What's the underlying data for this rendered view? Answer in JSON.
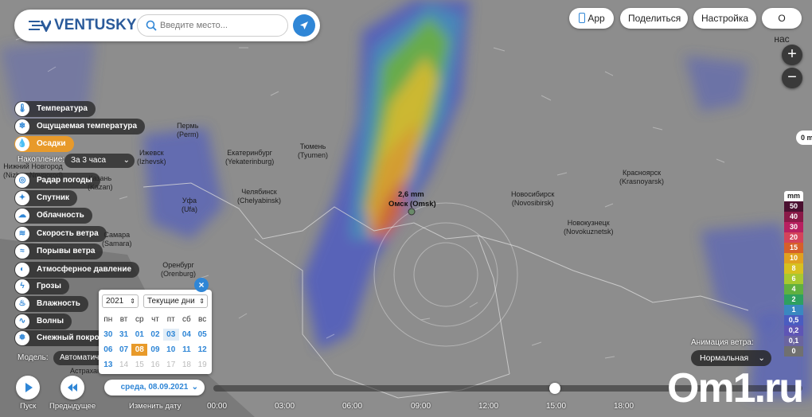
{
  "header": {
    "logo_text": "VENTUSKY",
    "search_placeholder": "Введите место..."
  },
  "top_buttons": {
    "app": "App",
    "share": "Поделиться",
    "settings": "Настройка",
    "about": "О нас"
  },
  "zoom": {
    "in": "+",
    "out": "−"
  },
  "layers": [
    {
      "label": "Температура",
      "icon": "thermometer-icon"
    },
    {
      "label": "Ощущаемая температура",
      "icon": "feels-like-icon"
    },
    {
      "label": "Осадки",
      "icon": "drop-icon",
      "active": true
    },
    {
      "label": "Радар погоды",
      "icon": "radar-icon"
    },
    {
      "label": "Спутник",
      "icon": "satellite-icon"
    },
    {
      "label": "Облачность",
      "icon": "cloud-icon"
    },
    {
      "label": "Скорость ветра",
      "icon": "wind-icon"
    },
    {
      "label": "Порывы ветра",
      "icon": "gust-icon"
    },
    {
      "label": "Атмосферное давление",
      "icon": "pressure-icon"
    },
    {
      "label": "Грозы",
      "icon": "lightning-icon"
    },
    {
      "label": "Влажность",
      "icon": "humidity-icon"
    },
    {
      "label": "Волны",
      "icon": "waves-icon"
    },
    {
      "label": "Снежный покров",
      "icon": "snowflake-icon"
    }
  ],
  "accumulation": {
    "label": "Накопление:",
    "value": "За 3 часа"
  },
  "model": {
    "label": "Модель:",
    "value": "Автоматич"
  },
  "calendar": {
    "year": "2021",
    "range": "Текущие дни",
    "weekdays": [
      "пн",
      "вт",
      "ср",
      "чт",
      "пт",
      "сб",
      "вс"
    ],
    "days": [
      {
        "t": "30"
      },
      {
        "t": "31"
      },
      {
        "t": "01"
      },
      {
        "t": "02"
      },
      {
        "t": "03",
        "hi": true
      },
      {
        "t": "04"
      },
      {
        "t": "05"
      },
      {
        "t": "06"
      },
      {
        "t": "07"
      },
      {
        "t": "08",
        "today": true
      },
      {
        "t": "09"
      },
      {
        "t": "10"
      },
      {
        "t": "11"
      },
      {
        "t": "12"
      },
      {
        "t": "13"
      },
      {
        "t": "14",
        "dim": true
      },
      {
        "t": "15",
        "dim": true
      },
      {
        "t": "16",
        "dim": true
      },
      {
        "t": "17",
        "dim": true
      },
      {
        "t": "18",
        "dim": true
      },
      {
        "t": "19",
        "dim": true
      }
    ]
  },
  "bottom": {
    "play": "Пуск",
    "previous": "Предыдущее",
    "change_date": "Изменить дату",
    "date": "среда, 08.09.2021",
    "hours": [
      "00:00",
      "03:00",
      "06:00",
      "09:00",
      "12:00",
      "15:00",
      "18:00"
    ],
    "timeline_position": 0.58
  },
  "wind_animation": {
    "label": "Анимация ветра:",
    "value": "Нормальная"
  },
  "legend": {
    "unit": "mm",
    "items": [
      {
        "v": "50",
        "c": "#4a1030"
      },
      {
        "v": "40",
        "c": "#8a1a48"
      },
      {
        "v": "30",
        "c": "#b82060"
      },
      {
        "v": "20",
        "c": "#d4435a"
      },
      {
        "v": "15",
        "c": "#d65f2a"
      },
      {
        "v": "10",
        "c": "#e0a020"
      },
      {
        "v": "8",
        "c": "#d7c020"
      },
      {
        "v": "6",
        "c": "#a8c830"
      },
      {
        "v": "4",
        "c": "#60b040"
      },
      {
        "v": "2",
        "c": "#2ea060"
      },
      {
        "v": "1",
        "c": "#3a88c0"
      },
      {
        "v": "0,5",
        "c": "#4a5cc0"
      },
      {
        "v": "0,2",
        "c": "#5e55b5"
      },
      {
        "v": "0,1",
        "c": "#6a64a0"
      },
      {
        "v": "0",
        "c": "#707070"
      }
    ]
  },
  "cursor_readout": "0 m",
  "map_labels": {
    "perm": "Пермь\n(Perm)",
    "izhevsk": "Ижевск\n(Izhevsk)",
    "ekb": "Екатеринбург\n(Yekaterinburg)",
    "tyumen": "Тюмень\n(Tyumen)",
    "nn": "Нижний Новгород\n(Nizhny Novgorod)",
    "kazan": "Казань\n(Kazan)",
    "ufa": "Уфа\n(Ufa)",
    "chel": "Челябинск\n(Chelyabinsk)",
    "samara": "Самара\n(Samara)",
    "orenburg": "Оренбург\n(Orenburg)",
    "astrakhan": "Астрахань",
    "novosib": "Новосибирск\n(Novosibirsk)",
    "novokuz": "Новокузнецк\n(Novokuznetsk)",
    "krasnoyarsk": "Красноярск\n(Krasnoyarsk)",
    "omsk_value": "2,6 mm",
    "omsk": "Омск (Omsk)"
  },
  "watermark": "Om1.ru"
}
